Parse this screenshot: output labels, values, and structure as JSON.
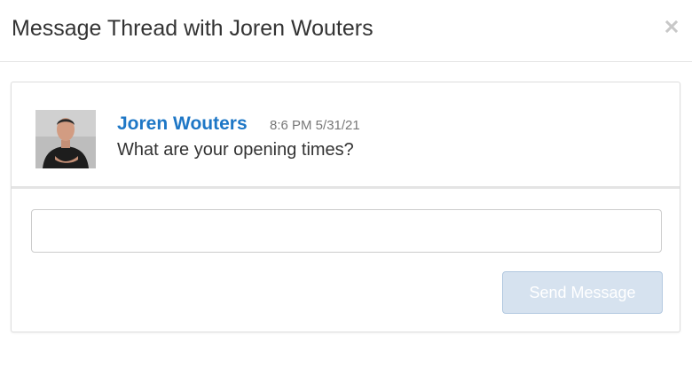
{
  "modal": {
    "title": "Message Thread with Joren Wouters",
    "close_icon": "close-icon"
  },
  "thread": {
    "messages": [
      {
        "sender": "Joren Wouters",
        "timestamp": "8:6 PM 5/31/21",
        "text": "What are your opening times?",
        "avatar_icon": "avatar-photo"
      }
    ]
  },
  "reply": {
    "value": "",
    "placeholder": "",
    "send_label": "Send Message",
    "send_disabled": true
  },
  "colors": {
    "sender_link": "#1e77c6",
    "send_button_bg": "#d6e2ef",
    "send_button_border": "#b3c9e0"
  }
}
